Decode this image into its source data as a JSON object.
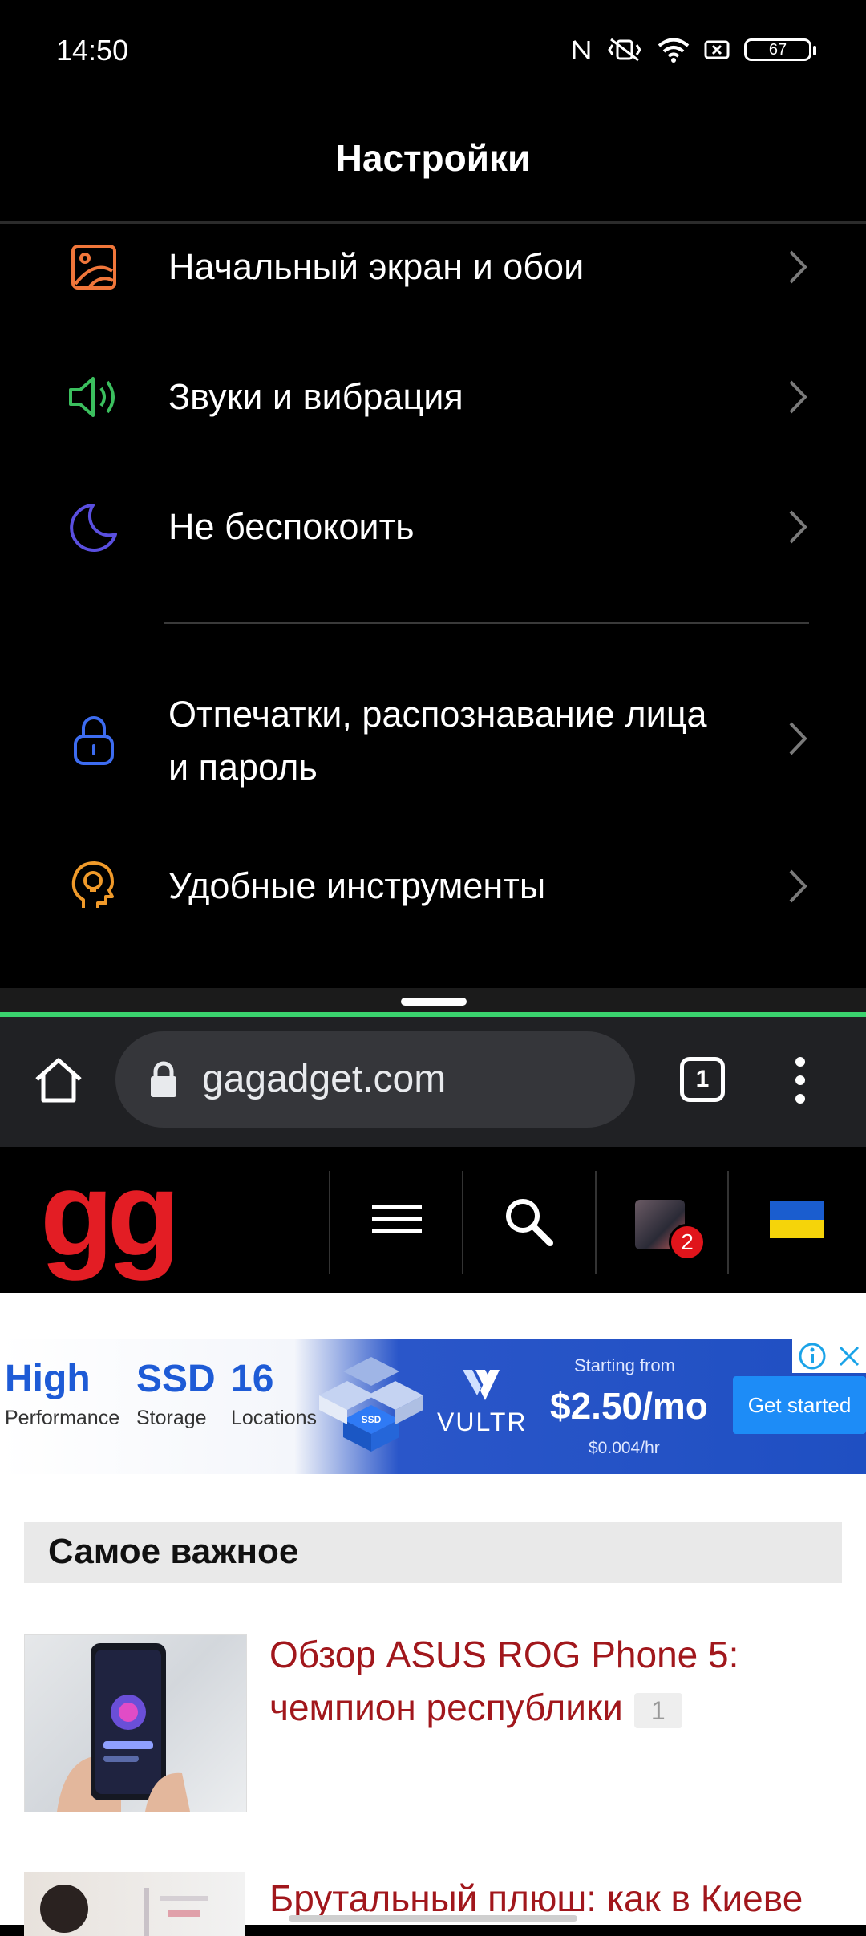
{
  "status_bar": {
    "time": "14:50",
    "battery": "67",
    "icons": [
      "nfc-icon",
      "vibrate-off-icon",
      "wifi-icon",
      "screen-record-icon",
      "battery-icon"
    ]
  },
  "settings": {
    "title": "Настройки",
    "items": [
      {
        "label": "Начальный экран и обои",
        "icon": "wallpaper-icon",
        "color": "#f0763a"
      },
      {
        "label": "Звуки и вибрация",
        "icon": "sound-icon",
        "color": "#3bbf5e"
      },
      {
        "label": "Не беспокоить",
        "icon": "moon-icon",
        "color": "#5a4fe0"
      },
      {
        "label_line1": "Отпечатки, распознавание лица",
        "label_line2": "и пароль",
        "icon": "lock-icon",
        "color": "#3d6cf0"
      },
      {
        "label": "Удобные инструменты",
        "icon": "head-bulb-icon",
        "color": "#f09a2a"
      }
    ]
  },
  "browser": {
    "url": "gagadget.com",
    "tab_count": "1"
  },
  "site": {
    "logo": "gg",
    "notification_count": "2",
    "logo_color": "#e31d24"
  },
  "ad": {
    "col1_big": "High",
    "col1_small": "Performance",
    "col2_big": "SSD",
    "col2_small": "Storage",
    "col3_big": "16",
    "col3_small": "Locations",
    "cube_label": "SSD",
    "brand": "VULTR",
    "starting_from": "Starting from",
    "price": "$2.50/mo",
    "hourly": "$0.004/hr",
    "cta": "Get started"
  },
  "content": {
    "section_title": "Самое важное",
    "articles": [
      {
        "title_line1": "Обзор ASUS ROG Phone 5:",
        "title_line2": "чемпион республики",
        "comments": "1"
      },
      {
        "title_line1": "Брутальный плюш: как в Киеве"
      }
    ]
  }
}
